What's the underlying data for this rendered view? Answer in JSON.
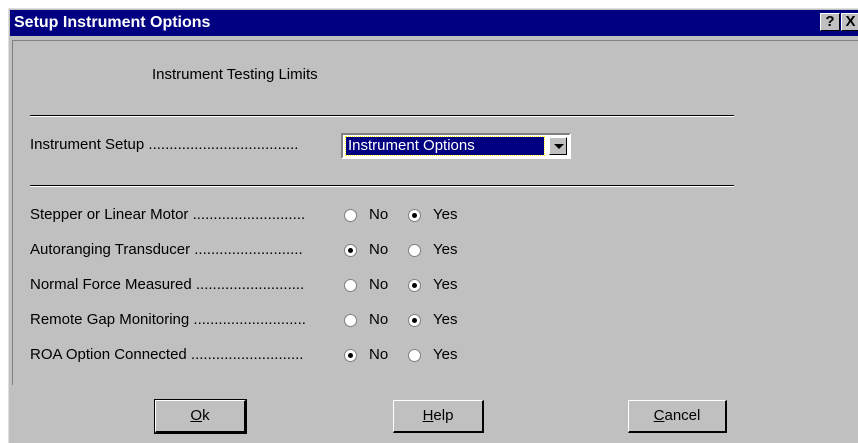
{
  "window": {
    "title": "Setup Instrument Options",
    "help_glyph": "?",
    "close_glyph": "X"
  },
  "section": {
    "title": "Instrument Testing Limits"
  },
  "instrument_setup": {
    "label": "Instrument Setup ....................................",
    "selected": "Instrument Options"
  },
  "options": [
    {
      "label": "Stepper or Linear Motor ...........................",
      "no": "No",
      "yes": "Yes",
      "value": "Yes"
    },
    {
      "label": "Autoranging Transducer ..........................",
      "no": "No",
      "yes": "Yes",
      "value": "No"
    },
    {
      "label": "Normal Force Measured ..........................",
      "no": "No",
      "yes": "Yes",
      "value": "Yes"
    },
    {
      "label": "Remote Gap Monitoring ...........................",
      "no": "No",
      "yes": "Yes",
      "value": "Yes"
    },
    {
      "label": "ROA Option Connected ...........................",
      "no": "No",
      "yes": "Yes",
      "value": "No"
    }
  ],
  "buttons": {
    "ok_first": "O",
    "ok_rest": "k",
    "help_first": "H",
    "help_rest": "elp",
    "cancel_first": "C",
    "cancel_rest": "ancel"
  }
}
